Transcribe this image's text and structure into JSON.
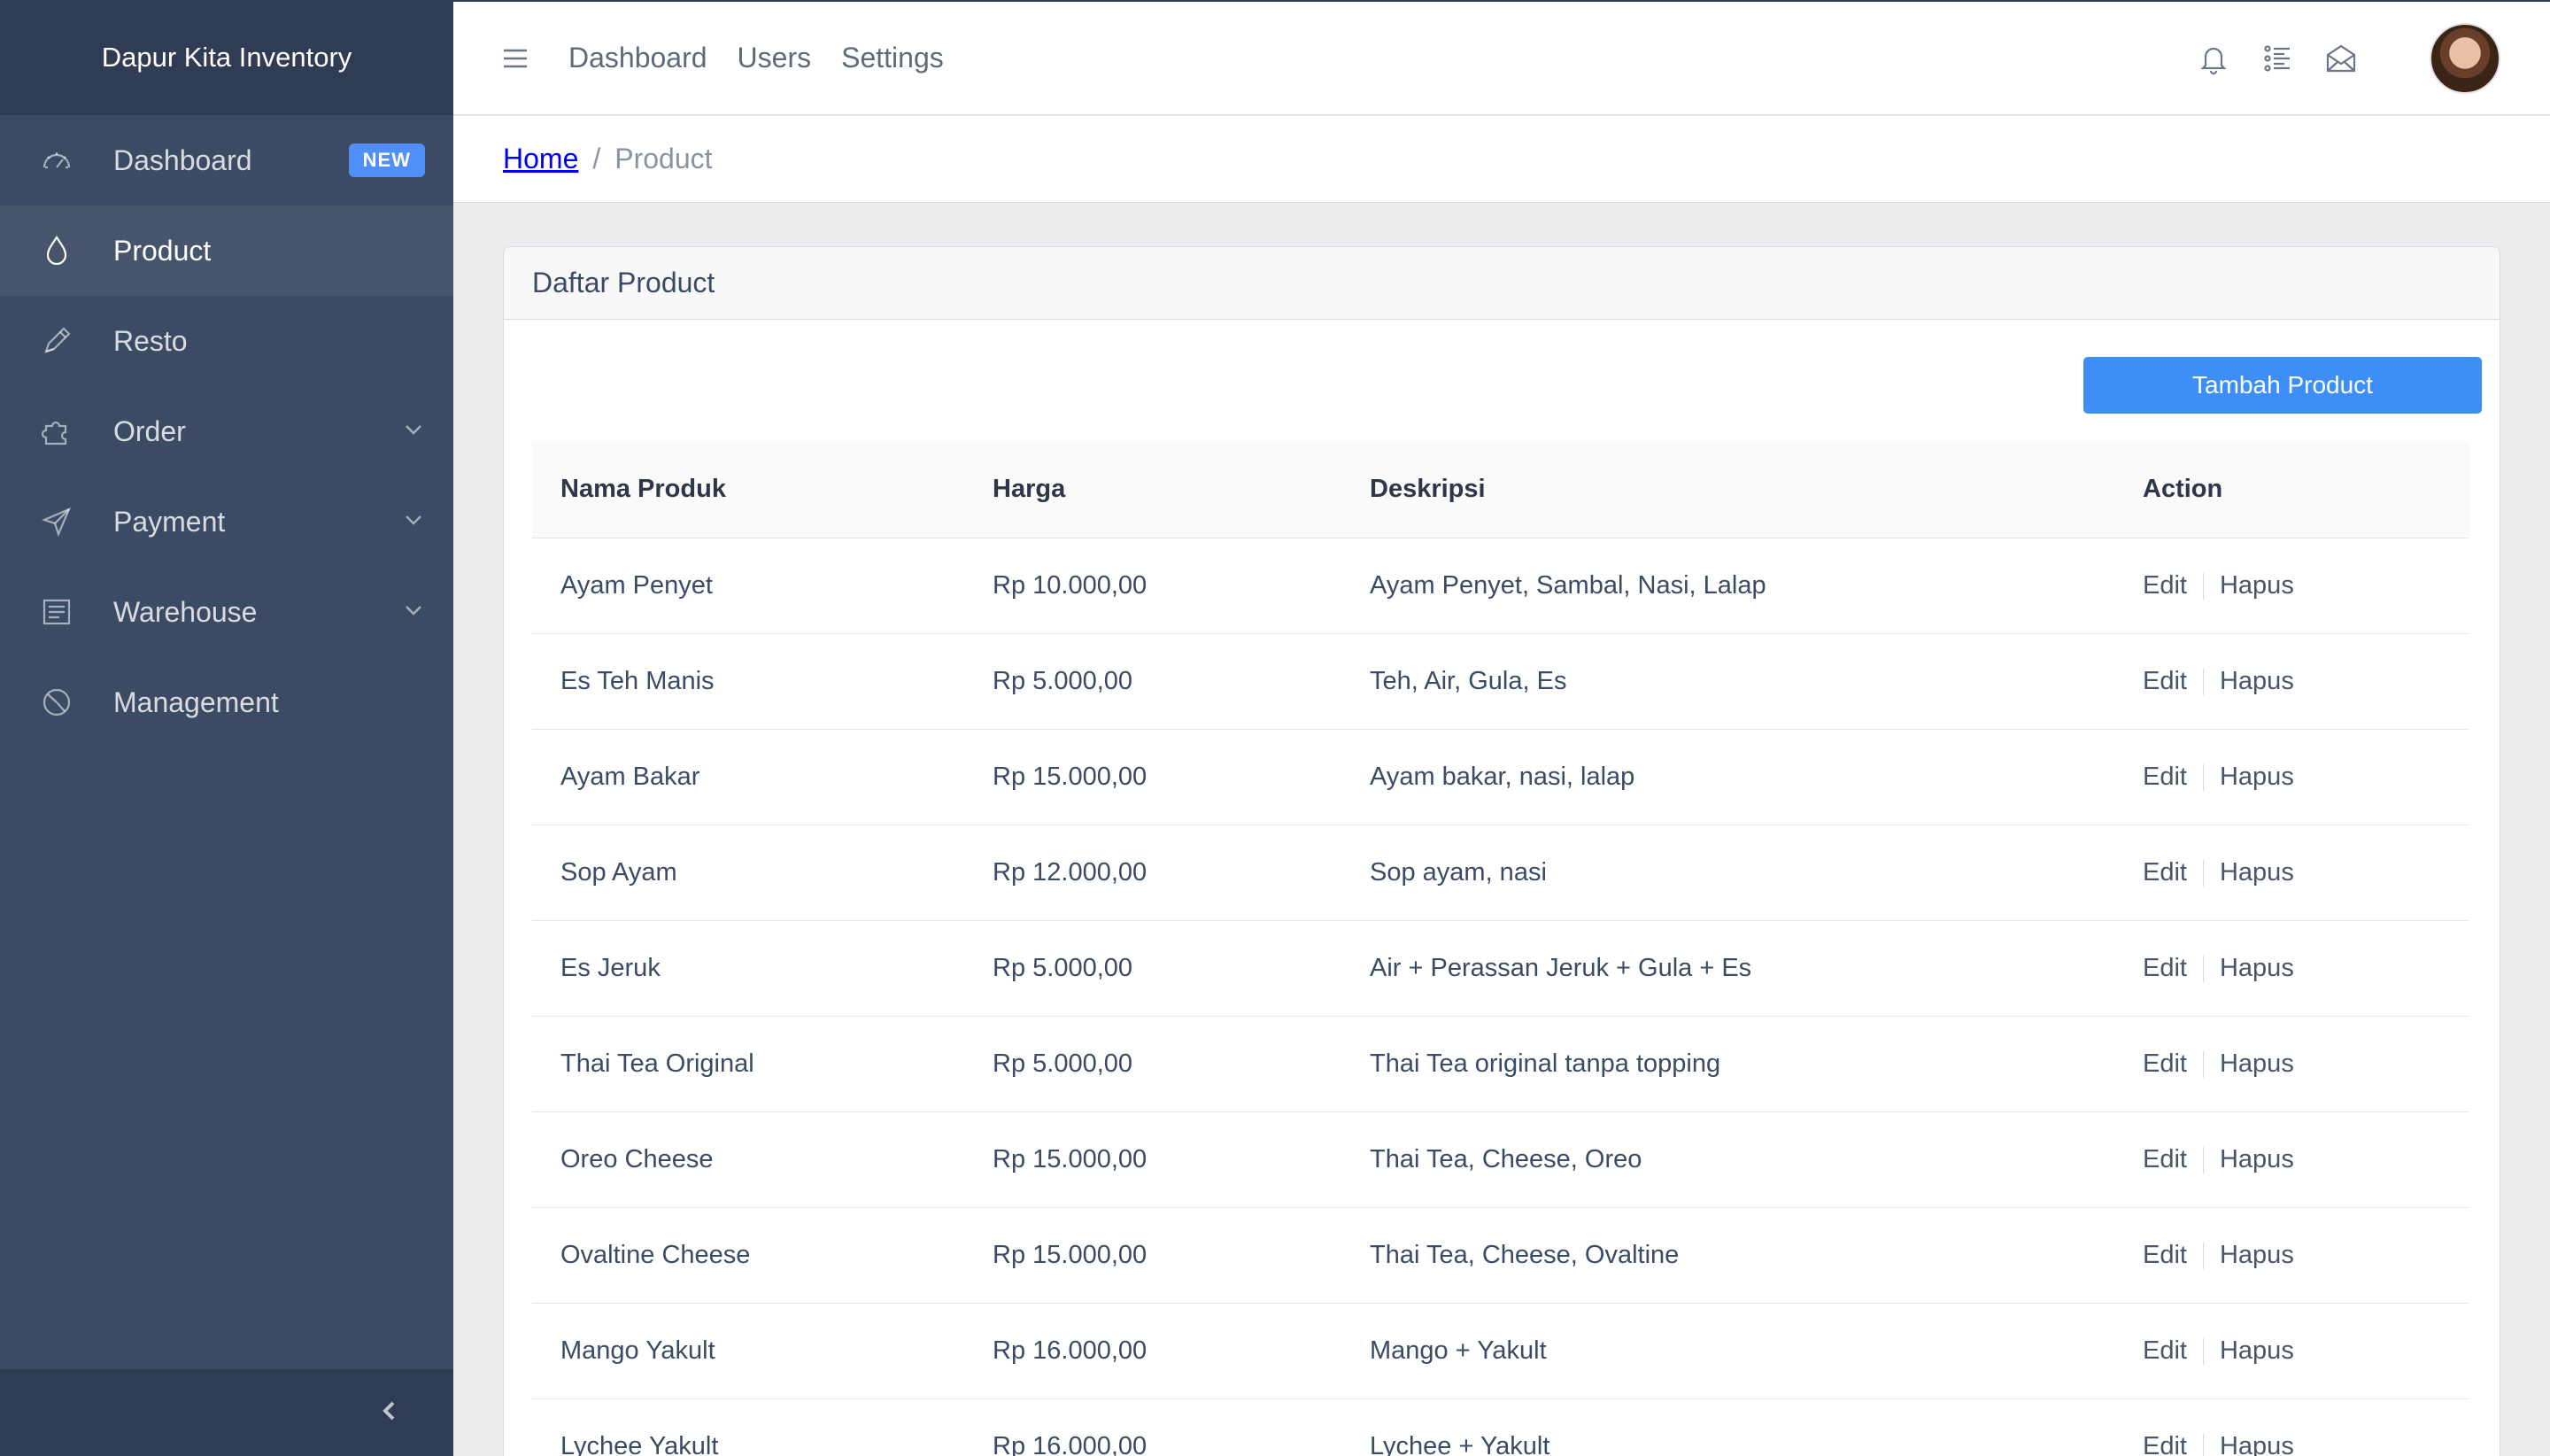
{
  "app": {
    "brand": "Dapur Kita Inventory"
  },
  "sidebar": {
    "items": [
      {
        "label": "Dashboard",
        "icon": "speedometer-icon",
        "badge": "NEW"
      },
      {
        "label": "Product",
        "icon": "drop-icon",
        "active": true
      },
      {
        "label": "Resto",
        "icon": "pencil-icon"
      },
      {
        "label": "Order",
        "icon": "puzzle-icon",
        "expandable": true
      },
      {
        "label": "Payment",
        "icon": "send-icon",
        "expandable": true
      },
      {
        "label": "Warehouse",
        "icon": "notes-icon",
        "expandable": true
      },
      {
        "label": "Management",
        "icon": "chart-pie-icon"
      }
    ],
    "toggle_icon": "chevron-left-icon"
  },
  "header": {
    "menu_icon": "hamburger-icon",
    "nav": [
      "Dashboard",
      "Users",
      "Settings"
    ],
    "icons": [
      "bell-icon",
      "list-icon",
      "envelope-open-icon"
    ],
    "avatar": "user-avatar"
  },
  "breadcrumb": {
    "home": "Home",
    "separator": "/",
    "current": "Product"
  },
  "card": {
    "title": "Daftar Product",
    "add_button": "Tambah Product",
    "columns": [
      "Nama Produk",
      "Harga",
      "Deskripsi",
      "Action"
    ],
    "rows": [
      {
        "name": "Ayam Penyet",
        "price": "Rp 10.000,00",
        "desc": "Ayam Penyet, Sambal, Nasi, Lalap"
      },
      {
        "name": "Es Teh Manis",
        "price": "Rp 5.000,00",
        "desc": "Teh, Air, Gula, Es"
      },
      {
        "name": "Ayam Bakar",
        "price": "Rp 15.000,00",
        "desc": "Ayam bakar, nasi, lalap"
      },
      {
        "name": "Sop Ayam",
        "price": "Rp 12.000,00",
        "desc": "Sop ayam, nasi"
      },
      {
        "name": "Es Jeruk",
        "price": "Rp 5.000,00",
        "desc": "Air + Perassan Jeruk + Gula + Es"
      },
      {
        "name": "Thai Tea Original",
        "price": "Rp 5.000,00",
        "desc": "Thai Tea original tanpa topping"
      },
      {
        "name": "Oreo Cheese",
        "price": "Rp 15.000,00",
        "desc": "Thai Tea, Cheese, Oreo"
      },
      {
        "name": "Ovaltine Cheese",
        "price": "Rp 15.000,00",
        "desc": "Thai Tea, Cheese, Ovaltine"
      },
      {
        "name": "Mango Yakult",
        "price": "Rp 16.000,00",
        "desc": "Mango + Yakult"
      },
      {
        "name": "Lychee Yakult",
        "price": "Rp 16.000,00",
        "desc": "Lychee + Yakult"
      }
    ],
    "action_edit": "Edit",
    "action_delete": "Hapus"
  },
  "colors": {
    "sidebar_bg": "#3c4b64",
    "sidebar_dark": "#303c54",
    "accent": "#3e8ef7",
    "badge": "#4f8ff7"
  }
}
